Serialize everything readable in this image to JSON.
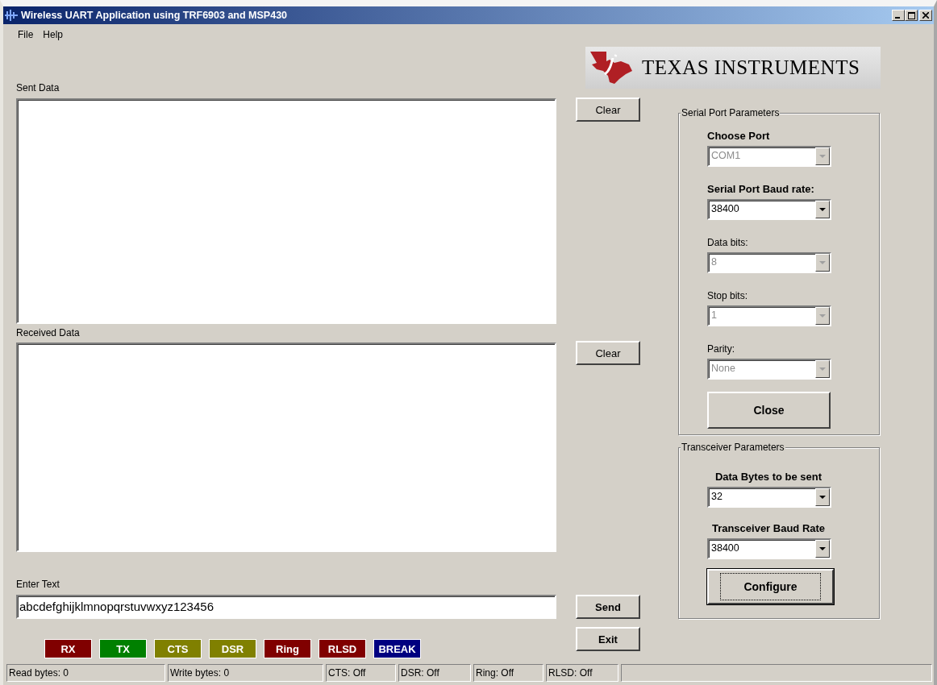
{
  "window": {
    "title": "Wireless UART Application using TRF6903 and MSP430"
  },
  "menu": [
    "File",
    "Help"
  ],
  "logo": {
    "text": "TEXAS INSTRUMENTS"
  },
  "sent_data": {
    "label": "Sent Data",
    "clear_button": {
      "label": "Clear",
      "bold": false
    }
  },
  "received_data": {
    "label": "Received Data",
    "clear_button": {
      "label": "Clear",
      "bold": false
    }
  },
  "enter_text": {
    "label": "Enter Text",
    "value": "abcdefghijklmnopqrstuvwxyz123456"
  },
  "action_buttons": [
    {
      "label": "Send",
      "bold": true
    },
    {
      "label": "Exit",
      "bold": true
    }
  ],
  "indicators": [
    {
      "label": "RX",
      "color": "#800000"
    },
    {
      "label": "TX",
      "color": "#008000"
    },
    {
      "label": "CTS",
      "color": "#808000"
    },
    {
      "label": "DSR",
      "color": "#808000"
    },
    {
      "label": "Ring",
      "color": "#800000"
    },
    {
      "label": "RLSD",
      "color": "#800000"
    },
    {
      "label": "BREAK",
      "color": "#000080"
    }
  ],
  "serial_port_parameters": {
    "title": "Serial Port Parameters",
    "fields": [
      {
        "label": "Choose Port",
        "emphasized": true,
        "value": "COM1",
        "disabled": true
      },
      {
        "label": "Serial Port Baud rate:",
        "emphasized": true,
        "value": "38400",
        "disabled": false
      },
      {
        "label": "Data bits:",
        "emphasized": false,
        "value": "8",
        "disabled": true
      },
      {
        "label": "Stop bits:",
        "emphasized": false,
        "value": "1",
        "disabled": true
      },
      {
        "label": "Parity:",
        "emphasized": false,
        "value": "None",
        "disabled": true
      }
    ],
    "button": {
      "label": "Close",
      "focused": false
    }
  },
  "transceiver_parameters": {
    "title": "Transceiver Parameters",
    "fields": [
      {
        "label": "Data Bytes to be sent",
        "emphasized": true,
        "value": "32",
        "disabled": false
      },
      {
        "label": "Transceiver Baud Rate",
        "emphasized": true,
        "value": "38400",
        "disabled": false
      }
    ],
    "button": {
      "label": "Configure",
      "focused": true
    }
  },
  "status_bar": [
    "Read bytes: 0",
    "Write bytes: 0",
    "CTS: Off",
    "DSR: Off",
    "Ring: Off",
    "RLSD: Off"
  ]
}
